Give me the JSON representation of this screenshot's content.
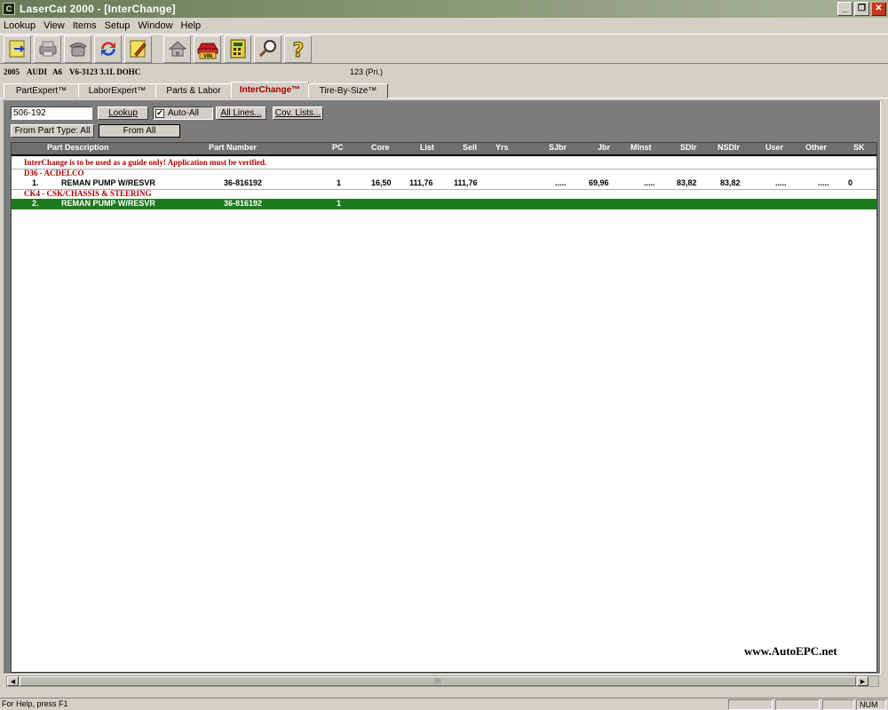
{
  "window": {
    "title": "LaserCat 2000 - [InterChange]",
    "icon_letter": "C"
  },
  "menu": [
    "Lookup",
    "View",
    "Items",
    "Setup",
    "Window",
    "Help"
  ],
  "toolbar": {
    "icons": [
      "export-arrow-icon",
      "printer-icon",
      "phone-icon",
      "recycle-icon",
      "edit-pencil-icon",
      "home-icon",
      "vin-car-icon",
      "calculator-icon",
      "magnifier-icon",
      "help-question-icon"
    ],
    "vin_label": "VIN"
  },
  "vehicle": {
    "year": "2005",
    "make": "AUDI",
    "model": "A6",
    "engine": "V6-3123 3.1L DOHC",
    "priority": "123 (Pri.)"
  },
  "tabs": [
    "PartExpert™",
    "LaborExpert™",
    "Parts & Labor",
    "InterChange™",
    "Tire-By-Size™"
  ],
  "active_tab": "InterChange™",
  "controls": {
    "search_value": "506-192",
    "lookup_label": "Lookup",
    "auto_all_label": "Auto-All",
    "auto_all_checked_mark": "✔",
    "all_lines_label": "All Lines...",
    "cov_lists_label": "Cov. Lists...",
    "from_part_type_label": "From Part Type: All",
    "from_all_label": "From All"
  },
  "grid": {
    "columns": [
      "Part Description",
      "Part Number",
      "PC",
      "Core",
      "List",
      "Sell",
      "Yrs",
      "SJbr",
      "Jbr",
      "MInst",
      "SDlr",
      "NSDlr",
      "User",
      "Other",
      "SK"
    ],
    "notice": "InterChange is to be used as a guide only!  Application must be verified.",
    "groups": [
      {
        "label": "D36 - ACDELCO",
        "rows": [
          {
            "num": "1.",
            "desc": "REMAN PUMP W/RESVR",
            "part": "36-816192",
            "pc": "1",
            "core": "16,50",
            "list": "111,76",
            "sell": "111,76",
            "yrs": "",
            "sjbr": ".....",
            "jbr": "69,96",
            "minst": ".....",
            "sdlr": "83,82",
            "nsdlr": "83,82",
            "user": ".....",
            "other": ".....",
            "sk": "0"
          }
        ]
      },
      {
        "label": "CK4 - CSK/CHASSIS & STEERING",
        "rows": [
          {
            "num": "2.",
            "desc": "REMAN PUMP W/RESVR",
            "part": "36-816192",
            "pc": "1",
            "core": "",
            "list": "",
            "sell": "",
            "yrs": "",
            "sjbr": "",
            "jbr": "",
            "minst": "",
            "sdlr": "",
            "nsdlr": "",
            "user": "",
            "other": "",
            "sk": "",
            "selected": true
          }
        ]
      }
    ]
  },
  "watermark_url": "www.AutoEPC.net",
  "scrollbar": {
    "thumb_grip": "III"
  },
  "status": {
    "help_text": "For Help, press F1",
    "num_lock": "NUM"
  },
  "colors": {
    "title_bar": "#7a8a66",
    "selected_row": "#1e7a1e",
    "notice_red": "#b00000",
    "header_gray": "#6f6f6f"
  }
}
